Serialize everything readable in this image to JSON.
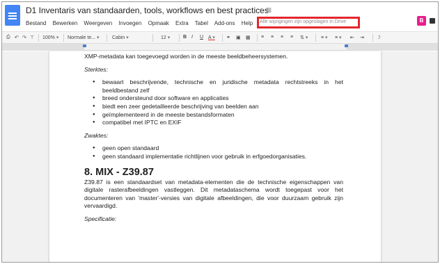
{
  "header": {
    "title": "D1 Inventaris van standaarden, tools, workflows en best practices",
    "save_status": "Alle wijzigingen zijn opgeslagen in Drive",
    "avatar_letter": "B",
    "icons": [
      "star-icon",
      "folder-icon"
    ]
  },
  "menu": {
    "items": [
      "Bestand",
      "Bewerken",
      "Weergeven",
      "Invoegen",
      "Opmaak",
      "Extra",
      "Tabel",
      "Add-ons",
      "Help"
    ]
  },
  "toolbar": {
    "zoom": "100%",
    "style": "Normale te...",
    "font": "Cabin",
    "font_size": "12",
    "bold": "B",
    "italic": "I",
    "underline": "U",
    "text_color": "A"
  },
  "document": {
    "intro_line": "XMP-metadata kan toegevoegd worden in de meeste beeldbeheersystemen.",
    "strengths_heading": "Sterktes:",
    "strengths": [
      "bewaart beschrijvende, technische en juridische metadata rechtstreeks in het beeldbestand zelf",
      "breed ondersteund door software en applicaties",
      "biedt een zeer gedetailleerde beschrijving van beelden aan",
      "geïmplementeerd in de meeste bestandsformaten",
      "compatibel met IPTC en EXIF"
    ],
    "weaknesses_heading": "Zwaktes:",
    "weaknesses": [
      "geen open standaard",
      "geen standaard implementatie richtlijnen voor gebruik in erfgoedorganisaties."
    ],
    "section_heading": "8. MIX - Z39.87",
    "section_paragraph": "Z39.87 is een standaardset van metadata-elementen die de technische eigenschappen van digitale rasterafbeeldingen vastleggen. Dit metadataschema wordt toegepast voor het documenteren van 'master'-versies van digitale afbeeldingen, die voor duurzaam gebruik zijn vervaardigd.",
    "spec_heading": "Specificatie:"
  },
  "colors": {
    "doc_blue": "#4285f4",
    "highlight_red": "#e4262d",
    "avatar_pink": "#e91e8c"
  }
}
